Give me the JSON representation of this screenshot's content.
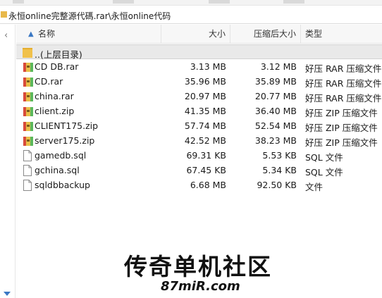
{
  "path": "永恒online完整源代碼.rar\\永恒online代码",
  "columns": {
    "name": "名称",
    "size": "大小",
    "packed": "压缩后大小",
    "type": "类型"
  },
  "parent_row": {
    "name": "..(上层目录)"
  },
  "files": [
    {
      "name": "CD DB.rar",
      "size": "3.13 MB",
      "packed": "3.12 MB",
      "type": "好压 RAR 压缩文件",
      "icon": "rar-archive-icon"
    },
    {
      "name": "CD.rar",
      "size": "35.96 MB",
      "packed": "35.89 MB",
      "type": "好压 RAR 压缩文件",
      "icon": "rar-archive-icon"
    },
    {
      "name": "china.rar",
      "size": "20.97 MB",
      "packed": "20.77 MB",
      "type": "好压 RAR 压缩文件",
      "icon": "rar-archive-icon"
    },
    {
      "name": "client.zip",
      "size": "41.35 MB",
      "packed": "36.40 MB",
      "type": "好压 ZIP 压缩文件",
      "icon": "zip-archive-icon"
    },
    {
      "name": "CLIENT175.zip",
      "size": "57.74 MB",
      "packed": "52.54 MB",
      "type": "好压 ZIP 压缩文件",
      "icon": "zip-archive-icon"
    },
    {
      "name": "server175.zip",
      "size": "42.52 MB",
      "packed": "38.23 MB",
      "type": "好压 ZIP 压缩文件",
      "icon": "zip-archive-icon"
    },
    {
      "name": "gamedb.sql",
      "size": "69.31 KB",
      "packed": "5.53 KB",
      "type": "SQL 文件",
      "icon": "file-icon"
    },
    {
      "name": "gchina.sql",
      "size": "67.45 KB",
      "packed": "5.34 KB",
      "type": "SQL 文件",
      "icon": "file-icon"
    },
    {
      "name": "sqldbbackup",
      "size": "6.68 MB",
      "packed": "92.50 KB",
      "type": "文件",
      "icon": "file-icon"
    }
  ],
  "watermark": {
    "title": "传奇单机社区",
    "url": "87miR.com"
  },
  "colors": {
    "accent": "#3b78c4",
    "header_bg": "#f7f7f7",
    "parent_row_bg": "#e9e9e9"
  }
}
